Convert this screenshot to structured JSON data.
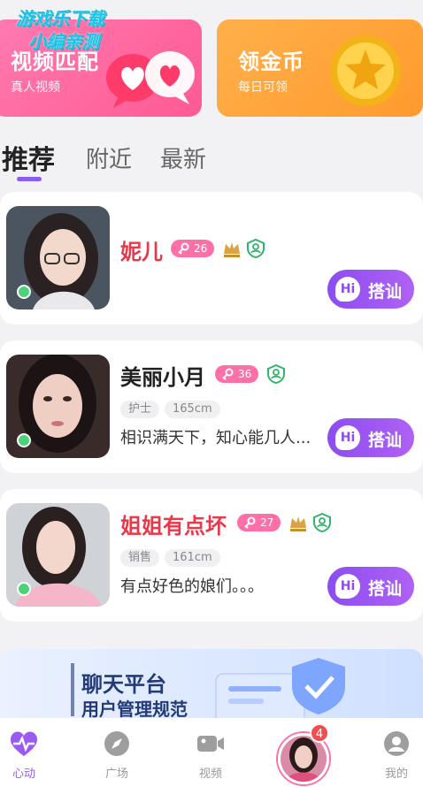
{
  "watermark": {
    "line1": "游戏乐下载",
    "line2": "小编亲测"
  },
  "banners": {
    "video_match": {
      "title": "视频匹配",
      "subtitle": "真人视频"
    },
    "coins": {
      "title": "领金币",
      "subtitle": "每日可领"
    }
  },
  "tabs": [
    {
      "label": "推荐",
      "active": true
    },
    {
      "label": "附近",
      "active": false
    },
    {
      "label": "最新",
      "active": false
    }
  ],
  "users": [
    {
      "name": "妮儿",
      "level": "26",
      "crown": true,
      "verified": true,
      "tags": [],
      "desc": "",
      "online": true,
      "name_color": "#e8394a"
    },
    {
      "name": "美丽小月",
      "level": "36",
      "crown": false,
      "verified": true,
      "tags": [
        "护士",
        "165cm"
      ],
      "desc": "相识满天下，知心能几人...",
      "online": true,
      "name_color": "#222222"
    },
    {
      "name": "姐姐有点坏",
      "level": "27",
      "crown": true,
      "verified": true,
      "tags": [
        "销售",
        "161cm"
      ],
      "desc": "有点好色的娘们。。。",
      "online": true,
      "name_color": "#e8394a"
    }
  ],
  "hi_button": {
    "badge": "Hi",
    "label": "搭讪"
  },
  "platform_banner": {
    "line1": "聊天平台",
    "line2": "用户管理规范"
  },
  "bottom_nav": [
    {
      "label": "心动",
      "icon": "heart-pulse-icon",
      "active": true
    },
    {
      "label": "广场",
      "icon": "compass-icon",
      "active": false
    },
    {
      "label": "视频",
      "icon": "video-camera-icon",
      "active": false
    },
    {
      "label": "",
      "icon": "avatar",
      "active": false,
      "badge": "4"
    },
    {
      "label": "我的",
      "icon": "user-icon",
      "active": false
    }
  ],
  "colors": {
    "accent": "#8b4df0",
    "pink": "#ff6fa8",
    "orange": "#ffa33c",
    "online": "#4cd37a"
  }
}
